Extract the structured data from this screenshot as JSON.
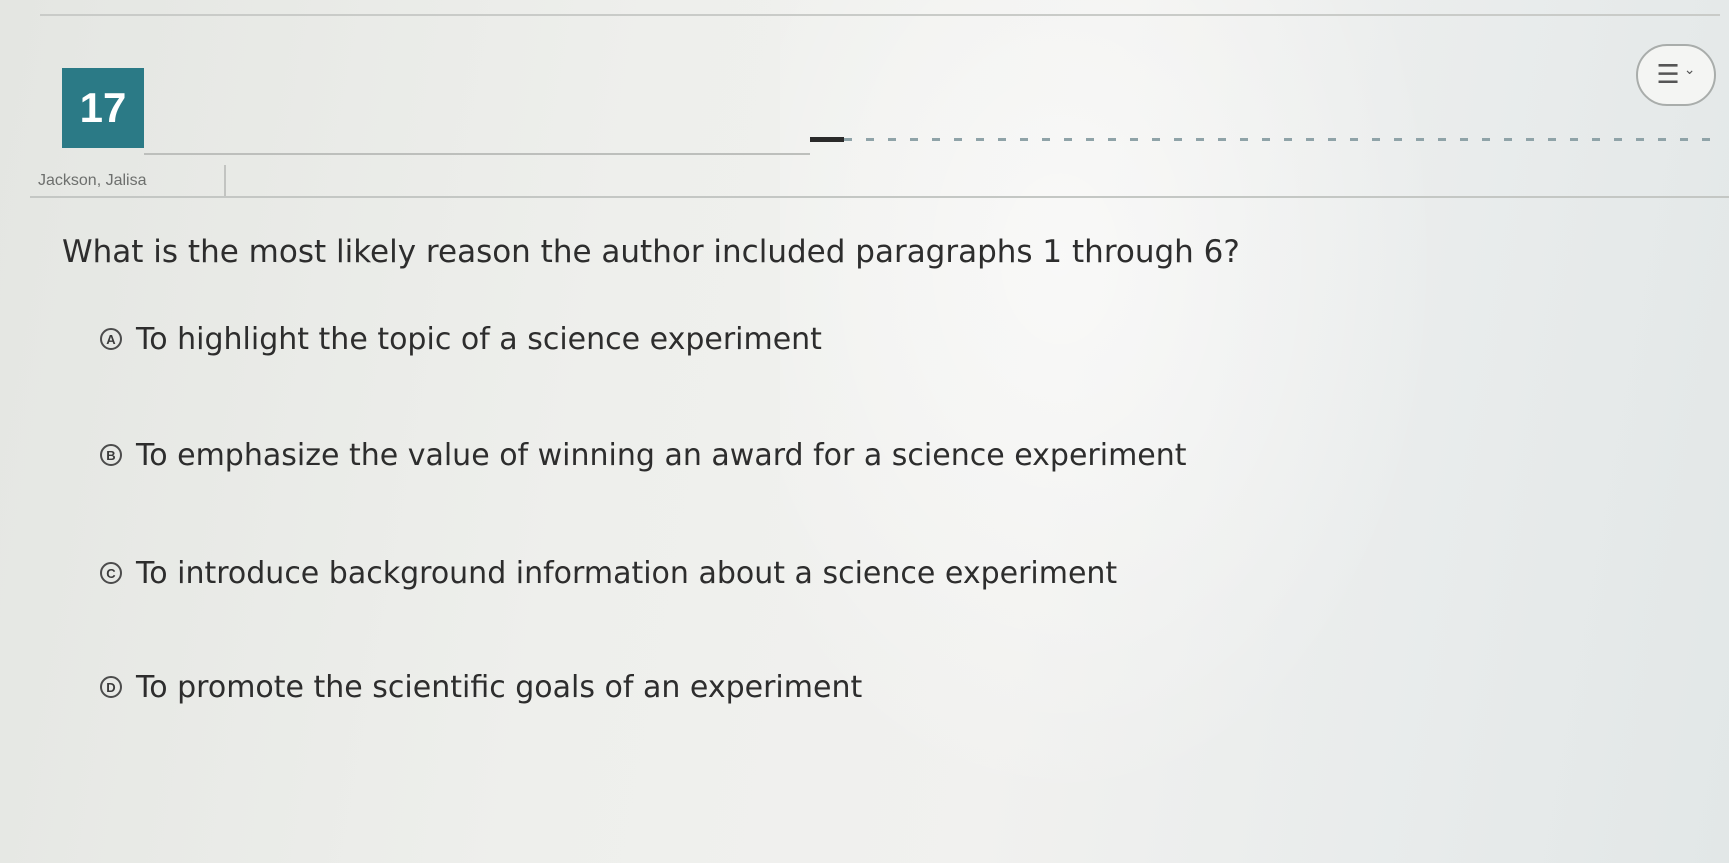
{
  "question_number": "17",
  "student_name": "Jackson, Jalisa",
  "question_text": "What is the most likely reason the author included paragraphs 1 through 6?",
  "options": [
    {
      "letter": "A",
      "text": "To highlight the topic of a science experiment"
    },
    {
      "letter": "B",
      "text": "To emphasize the value of winning an award for a science experiment"
    },
    {
      "letter": "C",
      "text": "To introduce background information about a science experiment"
    },
    {
      "letter": "D",
      "text": "To promote the scientific goals of an experiment"
    }
  ],
  "icons": {
    "menu": "hamburger-menu-icon",
    "menu_chevron": "chevron-down-icon"
  },
  "colors": {
    "question_badge": "#2b7a86",
    "text": "#2d2d2d"
  }
}
